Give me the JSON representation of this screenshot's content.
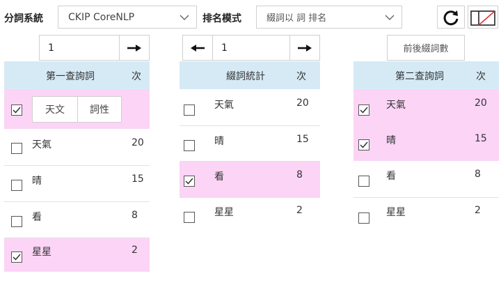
{
  "top": {
    "seg_system_label": "分詞系統",
    "seg_system_value": "CKIP CoreNLP",
    "rank_mode_label": "排名模式",
    "rank_mode_value": "綴詞以 詞 排名"
  },
  "pager_left": {
    "page": "1"
  },
  "pager_mid": {
    "page": "1"
  },
  "prefix_count_button": "前後綴詞數",
  "col1": {
    "header": "第一查詢詞",
    "count_header": "次",
    "filter_buttons": [
      "天文",
      "詞性"
    ],
    "rows": [
      {
        "word": "天氣",
        "count": "20",
        "checked": false
      },
      {
        "word": "晴",
        "count": "15",
        "checked": false
      },
      {
        "word": "看",
        "count": "8",
        "checked": false
      },
      {
        "word": "星星",
        "count": "2",
        "checked": true
      }
    ]
  },
  "col2": {
    "header": "綴詞統計",
    "count_header": "次",
    "rows": [
      {
        "word": "天氣",
        "count": "20",
        "checked": false
      },
      {
        "word": "晴",
        "count": "15",
        "checked": false
      },
      {
        "word": "看",
        "count": "8",
        "checked": true
      },
      {
        "word": "星星",
        "count": "2",
        "checked": false
      }
    ]
  },
  "col3": {
    "header": "第二查詢詞",
    "count_header": "次",
    "rows": [
      {
        "word": "天氣",
        "count": "20",
        "checked": true
      },
      {
        "word": "晴",
        "count": "15",
        "checked": true
      },
      {
        "word": "看",
        "count": "8",
        "checked": false
      },
      {
        "word": "星星",
        "count": "2",
        "checked": false
      }
    ]
  },
  "icons": [
    "chevron-down-icon",
    "arrow-right-icon",
    "arrow-left-icon",
    "refresh-icon",
    "layout-icon",
    "checkmark-icon"
  ],
  "colors": {
    "header_bg": "#d6eaf6",
    "selected_bg": "#fbd4f6"
  }
}
